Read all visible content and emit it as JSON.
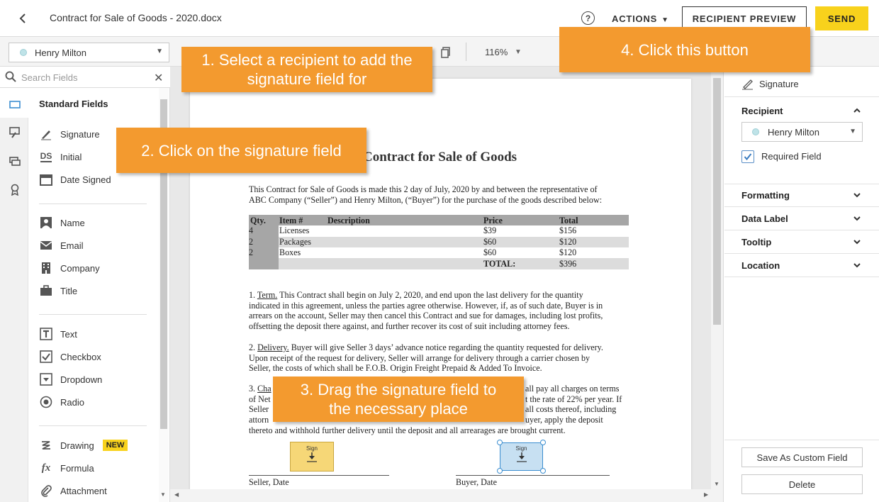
{
  "header": {
    "doc_title": "Contract for Sale of Goods - 2020.docx",
    "help_label": "?",
    "actions_label": "ACTIONS",
    "recipient_preview_label": "RECIPIENT PREVIEW",
    "send_label": "SEND"
  },
  "toolbar": {
    "recipient": "Henry Milton",
    "zoom": "116%"
  },
  "left_panel": {
    "search_placeholder": "Search Fields",
    "section_title": "Standard Fields",
    "groups": [
      [
        {
          "label": "Signature",
          "icon": "pen-icon"
        },
        {
          "label": "Initial",
          "icon": "initials-icon"
        },
        {
          "label": "Date Signed",
          "icon": "calendar-icon"
        }
      ],
      [
        {
          "label": "Name",
          "icon": "person-icon"
        },
        {
          "label": "Email",
          "icon": "envelope-icon"
        },
        {
          "label": "Company",
          "icon": "building-icon"
        },
        {
          "label": "Title",
          "icon": "briefcase-icon"
        }
      ],
      [
        {
          "label": "Text",
          "icon": "text-icon"
        },
        {
          "label": "Checkbox",
          "icon": "checkbox-icon"
        },
        {
          "label": "Dropdown",
          "icon": "dropdown-icon"
        },
        {
          "label": "Radio",
          "icon": "radio-icon"
        }
      ],
      [
        {
          "label": "Drawing",
          "icon": "drawing-icon",
          "badge": "NEW"
        },
        {
          "label": "Formula",
          "icon": "formula-icon"
        },
        {
          "label": "Attachment",
          "icon": "paperclip-icon"
        }
      ]
    ]
  },
  "document": {
    "title": "Contract for Sale of Goods",
    "intro": [
      "This Contract for Sale of Goods is made this 2 day of July, 2020 by and between the representative of",
      "ABC Company (“Seller”) and Henry Milton, (“Buyer”) for the purchase of the goods described below:"
    ],
    "table": {
      "headers": [
        "Qty.",
        "Item #",
        "Description",
        "Price",
        "Total"
      ],
      "rows": [
        [
          "4",
          "Licenses",
          "",
          "$39",
          "$156"
        ],
        [
          "2",
          "Packages",
          "",
          "$60",
          "$120"
        ],
        [
          "2",
          "Boxes",
          "",
          "$60",
          "$120"
        ]
      ],
      "total_label": "TOTAL:",
      "total_value": "$396"
    },
    "term_label": "Term.",
    "term_lines": [
      "This Contract shall begin on July 2, 2020, and end upon the last delivery for the quantity",
      "indicated in this agreement, unless the parties agree otherwise. However, if, as of such date, Buyer is in",
      "arrears on the account, Seller may then cancel this Contract and sue for damages, including lost profits,",
      "offsetting the deposit there against, and further recover its cost of suit including attorney fees."
    ],
    "delivery_label": "Delivery.",
    "delivery_lines": [
      "Buyer will give Seller 3 days’ advance notice regarding the quantity requested for delivery.",
      "Upon receipt of the request for delivery, Seller will arrange for delivery through a carrier chosen by",
      "Seller, the costs of which shall be F.O.B. Origin Freight Prepaid & Added To Invoice."
    ],
    "p3_label": "Cha",
    "p3_right": [
      "all pay all charges on terms",
      "t the rate of 22% per year. If",
      "all costs thereof, including",
      "uyer, apply the deposit"
    ],
    "p3_left": [
      "of Net",
      "Seller",
      "attorn"
    ],
    "p3_last": "thereto and withhold further delivery until the deposit and all arrearages are brought current.",
    "sign_label": "Sign",
    "seller_date": "Seller, Date",
    "buyer_date": "Buyer, Date"
  },
  "right_panel": {
    "field_type": "Signature",
    "recipient_section": "Recipient",
    "recipient": "Henry Milton",
    "required_label": "Required Field",
    "required_checked": true,
    "sections": [
      "Formatting",
      "Data Label",
      "Tooltip",
      "Location"
    ],
    "save_custom_label": "Save As Custom Field",
    "delete_label": "Delete"
  },
  "callouts": {
    "step1": "1. Select a recipient to add the signature field for",
    "step2": "2. Click on the signature field",
    "step3": "3. Drag the signature field to the necessary place",
    "step4": "4. Click this button"
  },
  "colors": {
    "callout": "#f39a2f",
    "send_button": "#f8d21c",
    "seller_sign": "#f6d777",
    "buyer_sign": "#c7e0f2",
    "selection": "#3b8ed0"
  }
}
